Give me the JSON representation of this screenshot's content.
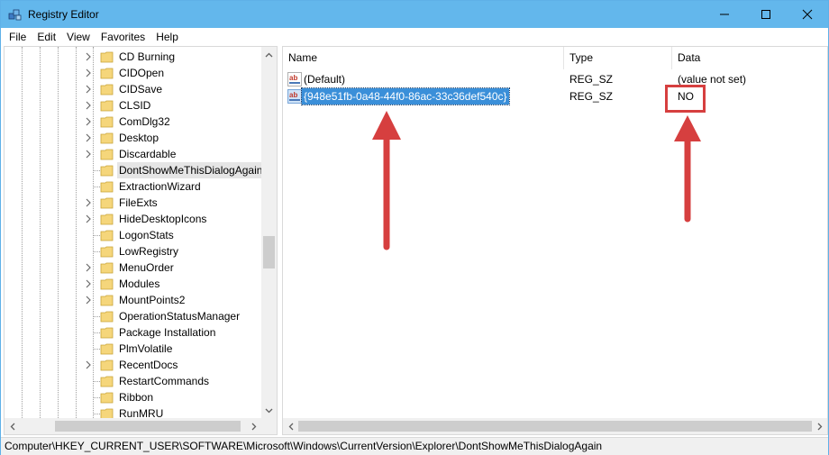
{
  "window": {
    "title": "Registry Editor",
    "icons": {
      "app": "registry-cubes-icon",
      "minimize": "minimize-icon",
      "maximize": "maximize-icon",
      "close": "close-icon"
    }
  },
  "menu": {
    "items": [
      "File",
      "Edit",
      "View",
      "Favorites",
      "Help"
    ]
  },
  "tree": {
    "items": [
      {
        "label": "CD Burning",
        "expandable": true
      },
      {
        "label": "CIDOpen",
        "expandable": true
      },
      {
        "label": "CIDSave",
        "expandable": true
      },
      {
        "label": "CLSID",
        "expandable": true
      },
      {
        "label": "ComDlg32",
        "expandable": true
      },
      {
        "label": "Desktop",
        "expandable": true
      },
      {
        "label": "Discardable",
        "expandable": true
      },
      {
        "label": "DontShowMeThisDialogAgain",
        "expandable": false,
        "selected": true
      },
      {
        "label": "ExtractionWizard",
        "expandable": false
      },
      {
        "label": "FileExts",
        "expandable": true
      },
      {
        "label": "HideDesktopIcons",
        "expandable": true
      },
      {
        "label": "LogonStats",
        "expandable": false
      },
      {
        "label": "LowRegistry",
        "expandable": false
      },
      {
        "label": "MenuOrder",
        "expandable": true
      },
      {
        "label": "Modules",
        "expandable": true
      },
      {
        "label": "MountPoints2",
        "expandable": true
      },
      {
        "label": "OperationStatusManager",
        "expandable": false
      },
      {
        "label": "Package Installation",
        "expandable": false
      },
      {
        "label": "PlmVolatile",
        "expandable": false
      },
      {
        "label": "RecentDocs",
        "expandable": true
      },
      {
        "label": "RestartCommands",
        "expandable": false
      },
      {
        "label": "Ribbon",
        "expandable": false
      },
      {
        "label": "RunMRU",
        "expandable": false
      }
    ]
  },
  "list": {
    "columns": {
      "name": "Name",
      "type": "Type",
      "data": "Data"
    },
    "rows": [
      {
        "name": "(Default)",
        "type": "REG_SZ",
        "data": "(value not set)",
        "selected": false
      },
      {
        "name": "{948e51fb-0a48-44f0-86ac-33c36def540c}",
        "type": "REG_SZ",
        "data": "NO",
        "selected": true
      }
    ],
    "value_icon": "reg-string-ab-icon"
  },
  "statusbar": {
    "path": "Computer\\HKEY_CURRENT_USER\\SOFTWARE\\Microsoft\\Windows\\CurrentVersion\\Explorer\\DontShowMeThisDialogAgain"
  },
  "colors": {
    "titlebar": "#63b7ec",
    "selection": "#3a8fd9",
    "annotation": "#d63f3f",
    "folder": "#f5d67b"
  }
}
